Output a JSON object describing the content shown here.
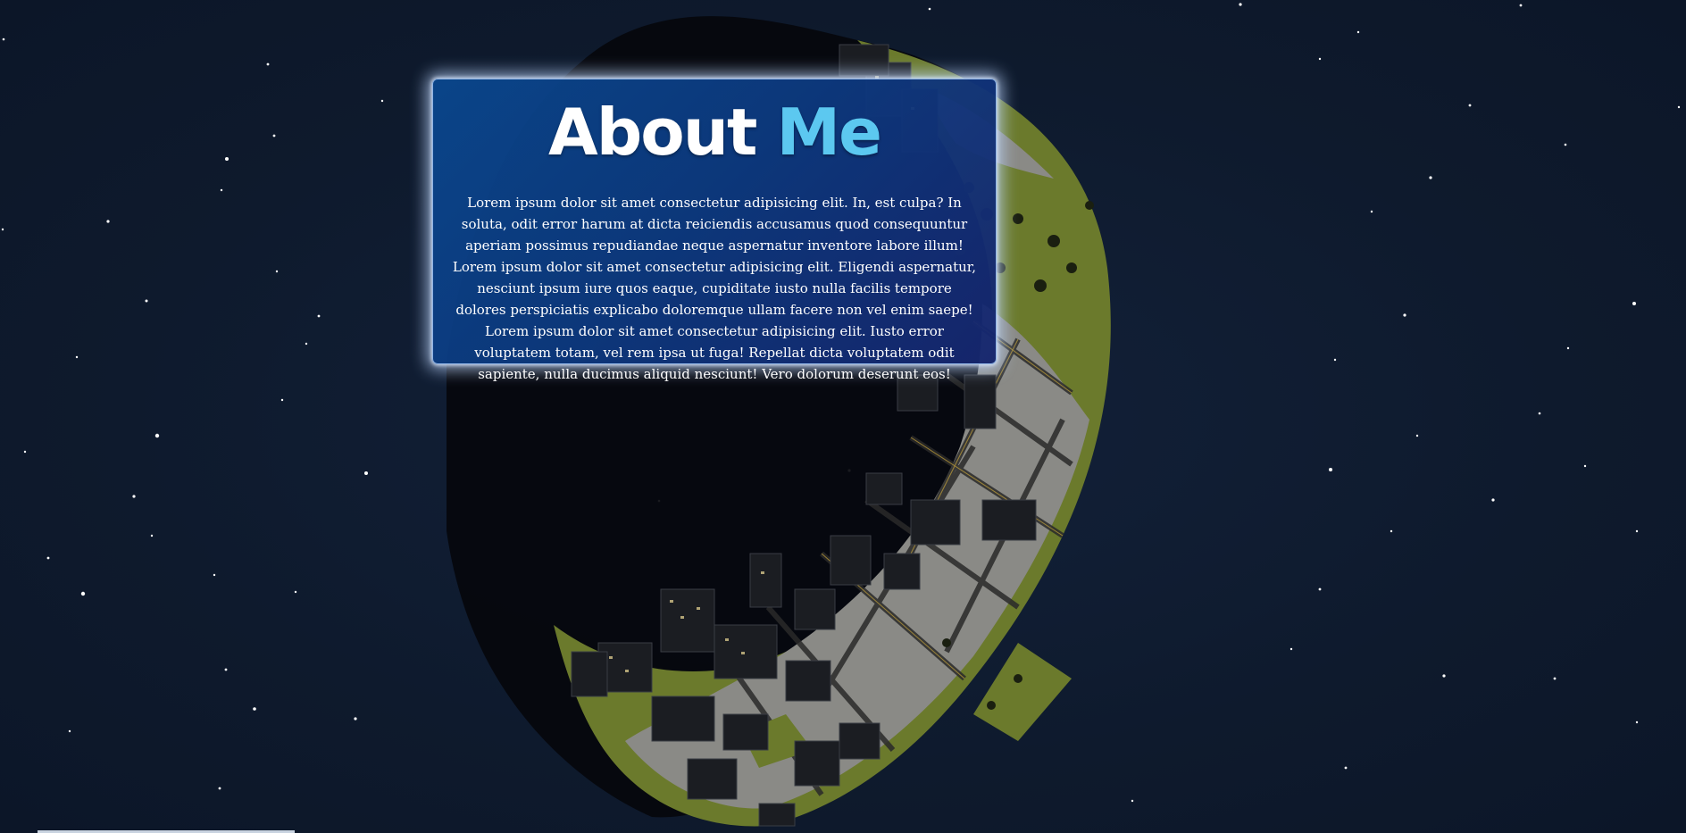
{
  "about": {
    "title_main": "About",
    "title_accent": "Me",
    "body": "Lorem ipsum dolor sit amet consectetur adipisicing elit. In, est culpa? In soluta, odit error harum at dicta reiciendis accusamus quod consequuntur aperiam possimus repudiandae neque aspernatur inventore labore illum! Lorem ipsum dolor sit amet consectetur adipisicing elit. Eligendi aspernatur, nesciunt ipsum iure quos eaque, cupiditate iusto nulla facilis tempore dolores perspiciatis explicabo doloremque ullam facere non vel enim saepe! Lorem ipsum dolor sit amet consectetur adipisicing elit. Iusto error voluptatem totam, vel rem ipsa ut fuga! Repellat dicta voluptatem odit sapiente, nulla ducimus aliquid nesciunt! Vero dolorum deserunt eos!"
  },
  "colors": {
    "background": "#0f1a2e",
    "accent": "#5cc8f0",
    "card": "#0c468c",
    "grass": "#6b7a2c",
    "road": "#8a8a86"
  },
  "scene": {
    "background_name": "starfield",
    "object_name": "rotating-city-planet"
  }
}
